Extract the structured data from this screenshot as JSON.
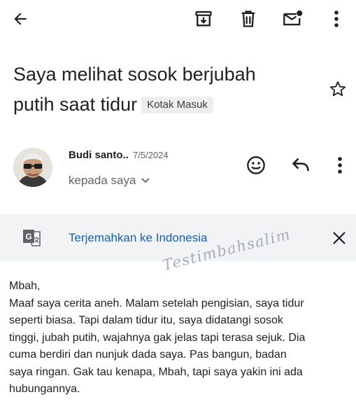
{
  "toolbar": {
    "back_icon": "arrow-left-icon",
    "archive_icon": "archive-icon",
    "delete_icon": "trash-icon",
    "mark_unread_icon": "mail-dot-icon",
    "more_icon": "more-vertical-icon"
  },
  "email": {
    "subject_line1": "Saya melihat sosok berjubah",
    "subject_line2": "putih saat tidur",
    "label": "Kotak Masuk",
    "sender": "Budi santo..",
    "date": "7/5/2024",
    "recipient": "kepada saya",
    "body": [
      "Mbah,",
      "Maaf saya cerita aneh. Malam setelah pengisian, saya tidur",
      "seperti biasa. Tapi dalam tidur itu, saya didatangi sosok",
      "tinggi, jubah putih, wajahnya gak jelas tapi terasa sejuk. Dia",
      "cuma berdiri dan nunjuk dada saya. Pas bangun, badan",
      "saya ringan. Gak tau kenapa, Mbah, tapi saya yakin ini ada",
      "hubungannya."
    ]
  },
  "translate": {
    "label": "Terjemahkan ke Indonesia"
  },
  "watermark": "Testimbahsalim",
  "colors": {
    "link": "#1a5fb4",
    "bar": "#f1f3f4",
    "chip": "#eeeeee"
  }
}
